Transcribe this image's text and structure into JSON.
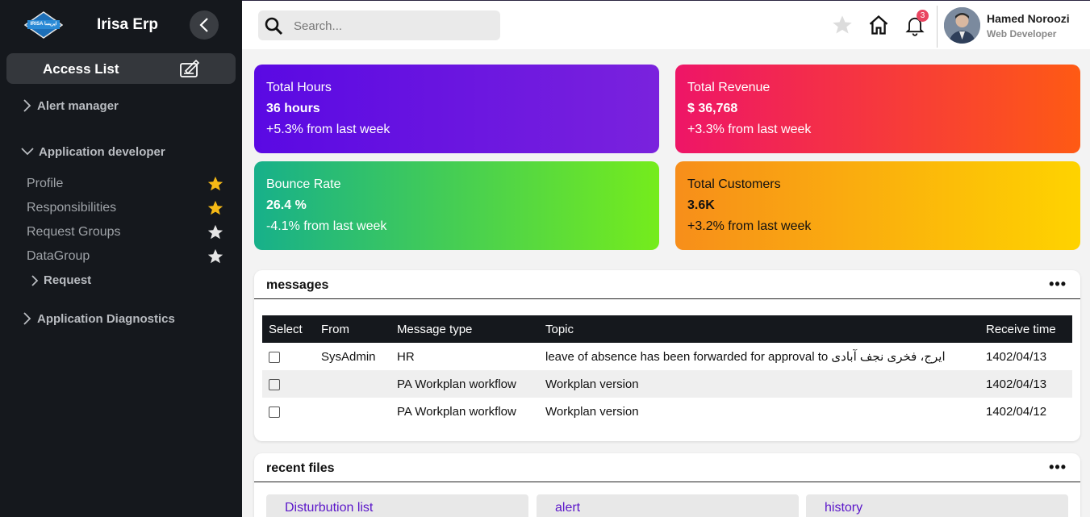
{
  "sidebar": {
    "app_name": "Irisa Erp",
    "logo_text": "IRISA ایریسا",
    "access_list_label": "Access List",
    "groups": {
      "alert_manager": "Alert manager",
      "application_developer": "Application developer",
      "application_diagnostics": "Application Diagnostics"
    },
    "items": [
      {
        "label": "Profile",
        "starred": true
      },
      {
        "label": "Responsibilities",
        "starred": true
      },
      {
        "label": "Request Groups",
        "starred": false
      },
      {
        "label": "DataGroup",
        "starred": false
      }
    ],
    "sub_group": "Request"
  },
  "header": {
    "search_placeholder": "Search...",
    "notification_count": "3",
    "user_name": "Hamed Noroozi",
    "user_role": "Web Developer"
  },
  "stats": [
    {
      "title": "Total Hours",
      "value": "36 hours",
      "change": "+5.3% from last week"
    },
    {
      "title": "Total Revenue",
      "value": "$ 36,768",
      "change": "+3.3% from last week"
    },
    {
      "title": "Bounce Rate",
      "value": "26.4 %",
      "change": "-4.1% from last week"
    },
    {
      "title": "Total Customers",
      "value": "3.6K",
      "change": "+3.2% from last week"
    }
  ],
  "messages": {
    "title": "messages",
    "menu": "•••",
    "columns": [
      "Select",
      "From",
      "Message type",
      "Topic",
      "Receive time"
    ],
    "rows": [
      {
        "from": "SysAdmin",
        "type": "HR",
        "topic": "leave of absence has been forwarded for approval to ایرج، فخری نجف آبادی",
        "time": "1402/04/13"
      },
      {
        "from": "",
        "type": "PA Workplan workflow",
        "topic": "Workplan version",
        "time": "1402/04/13"
      },
      {
        "from": "",
        "type": "PA Workplan workflow",
        "topic": "Workplan version",
        "time": "1402/04/12"
      }
    ]
  },
  "recent_files": {
    "title": "recent files",
    "menu": "•••",
    "files": [
      "Disturbution list",
      "alert",
      "history"
    ]
  },
  "colors": {
    "sidebar_bg": "#15181d",
    "star_active": "#f5b916",
    "star_inactive": "#e6e6e6",
    "file_link": "#5a15c9"
  }
}
